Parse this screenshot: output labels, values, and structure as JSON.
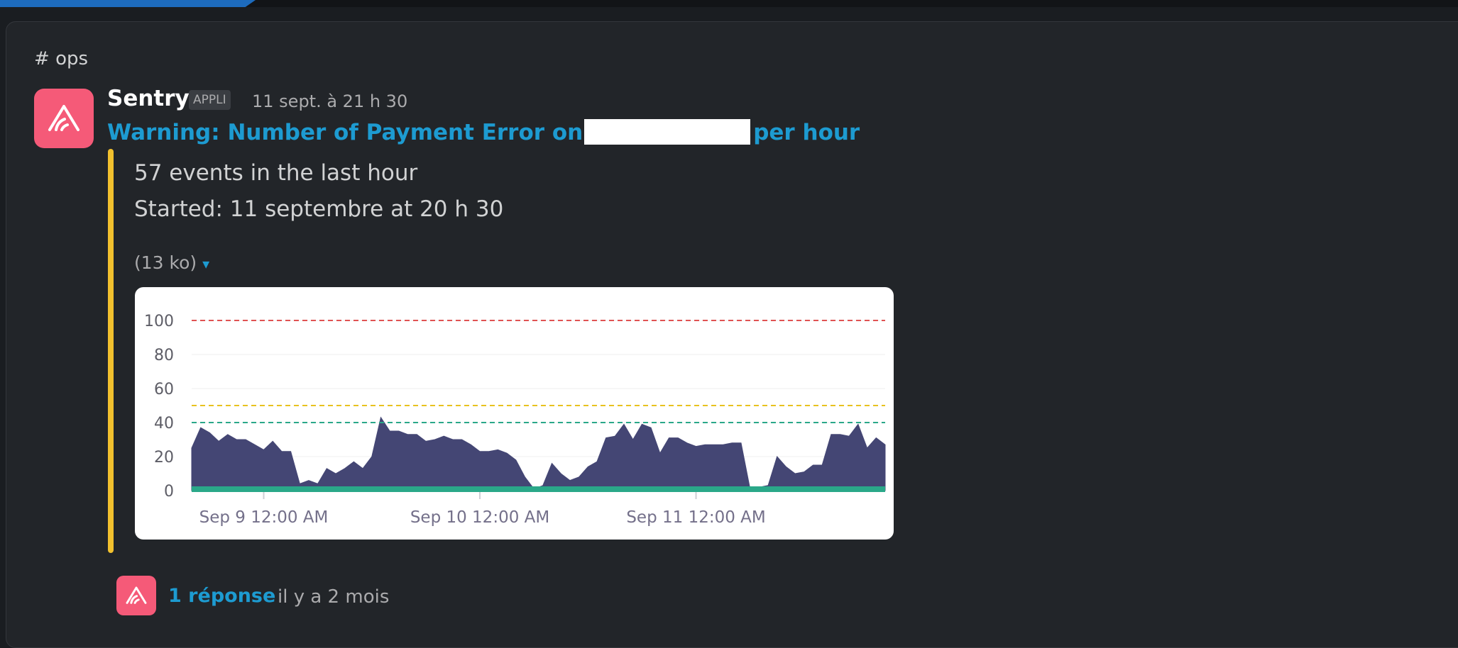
{
  "channel": {
    "hash": "#",
    "name": "ops"
  },
  "message": {
    "sender": "Sentry",
    "badge": "APPLI",
    "timestamp": "11 sept. à 21 h 30",
    "title_prefix": "Warning: Number of Payment Error on",
    "title_suffix": "per hour",
    "line1": "57 events in the last hour",
    "line2": "Started: 11 septembre at 20 h 30",
    "attachment_size": "(13 ko)",
    "caret": "▾"
  },
  "reply": {
    "count": "1 réponse",
    "time": "il y a 2 mois"
  },
  "colors": {
    "accent": "#1d9bd1",
    "attachment_bar": "#f2c12e",
    "avatar": "#f55a78",
    "area_fill": "#444674",
    "baseline": "#2aa889"
  },
  "chart_data": {
    "type": "area",
    "ylim": [
      0,
      100
    ],
    "yticks": [
      0,
      20,
      40,
      60,
      80,
      100
    ],
    "xtick_labels": [
      "Sep 9 12:00 AM",
      "Sep 10 12:00 AM",
      "Sep 11 12:00 AM"
    ],
    "xtick_index": [
      8,
      32,
      56
    ],
    "thresholds": [
      {
        "value": 100,
        "color": "#e05252"
      },
      {
        "value": 50,
        "color": "#e8c21f"
      },
      {
        "value": 40,
        "color": "#2aa889"
      }
    ],
    "baseline": 0,
    "values": [
      25,
      37,
      34,
      29,
      33,
      30,
      30,
      27,
      24,
      29,
      23,
      23,
      4,
      6,
      4,
      13,
      10,
      13,
      17,
      13,
      20,
      43,
      35,
      35,
      33,
      33,
      29,
      30,
      32,
      30,
      30,
      27,
      23,
      23,
      24,
      22,
      18,
      8,
      1,
      3,
      16,
      10,
      6,
      8,
      14,
      17,
      31,
      32,
      39,
      30,
      39,
      37,
      22,
      31,
      31,
      28,
      26,
      27,
      27,
      27,
      28,
      28,
      1,
      2,
      3,
      20,
      14,
      10,
      11,
      15,
      15,
      33,
      33,
      32,
      39,
      25,
      31,
      27
    ]
  }
}
